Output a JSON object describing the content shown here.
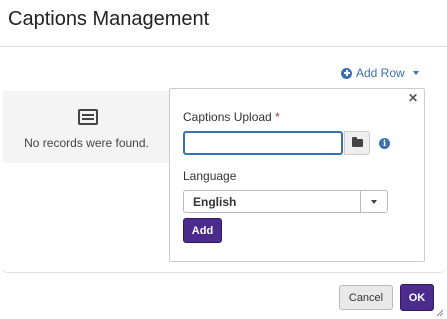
{
  "dialog": {
    "title": "Captions Management"
  },
  "toolbar": {
    "add_row_label": "Add Row"
  },
  "empty_state": {
    "message": "No records were found."
  },
  "popover": {
    "upload_label": "Captions Upload",
    "required_marker": "*",
    "upload_value": "",
    "language_label": "Language",
    "language_selected": "English",
    "add_label": "Add"
  },
  "footer": {
    "cancel_label": "Cancel",
    "ok_label": "OK"
  },
  "colors": {
    "link": "#3a6fb0",
    "primary": "#4b2c8c",
    "required": "#c0392b"
  }
}
